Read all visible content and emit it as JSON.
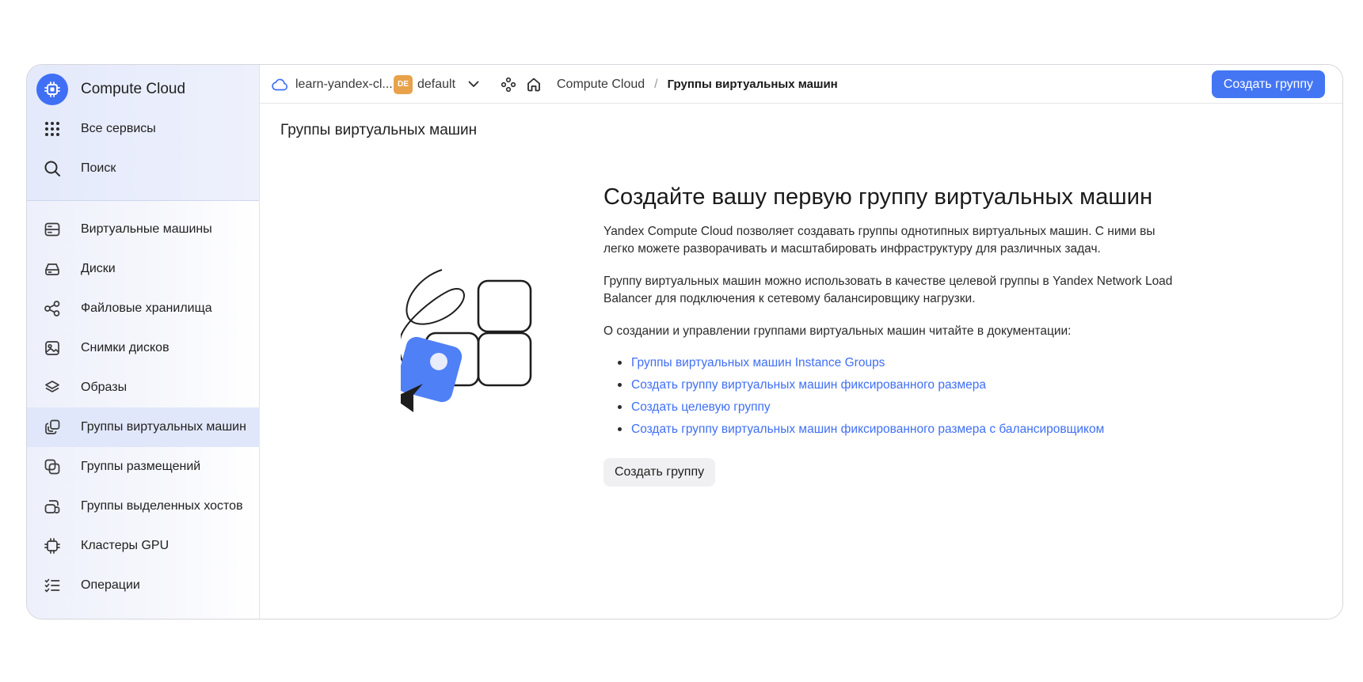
{
  "sidebar": {
    "brand": "Compute Cloud",
    "all_services": "Все сервисы",
    "search": "Поиск",
    "items": [
      {
        "label": "Виртуальные машины",
        "icon": "server-icon"
      },
      {
        "label": "Диски",
        "icon": "disk-icon"
      },
      {
        "label": "Файловые хранилища",
        "icon": "share-nodes-icon"
      },
      {
        "label": "Снимки дисков",
        "icon": "image-icon"
      },
      {
        "label": "Образы",
        "icon": "layers-icon"
      },
      {
        "label": "Группы виртуальных машин",
        "icon": "instance-groups-icon",
        "active": true
      },
      {
        "label": "Группы размещений",
        "icon": "placement-groups-icon"
      },
      {
        "label": "Группы выделенных хостов",
        "icon": "dedicated-hosts-icon"
      },
      {
        "label": "Кластеры GPU",
        "icon": "chip-icon"
      },
      {
        "label": "Операции",
        "icon": "list-check-icon"
      }
    ]
  },
  "topbar": {
    "cloud": "learn-yandex-cl...",
    "folder_badge": "DE",
    "folder": "default",
    "breadcrumb": [
      "Compute Cloud",
      "Группы виртуальных машин"
    ],
    "separator": "/",
    "create_button": "Создать группу"
  },
  "main": {
    "page_title": "Группы виртуальных машин",
    "heading": "Создайте вашу первую группу виртуальных машин",
    "paragraphs": [
      "Yandex Compute Cloud позволяет создавать группы однотипных виртуальных машин. С ними вы легко можете разворачивать и масштабировать инфраструктуру для различных задач.",
      "Группу виртуальных машин можно использовать в качестве целевой группы в Yandex Network Load Balancer для подключения к сетевому балансировщику нагрузки.",
      "О создании и управлении группами виртуальных машин читайте в документации:"
    ],
    "links": [
      "Группы виртуальных машин Instance Groups",
      "Создать группу виртуальных машин фиксированного размера",
      "Создать целевую группу",
      "Создать группу виртуальных машин фиксированного размера с балансировщиком"
    ],
    "create_button": "Создать группу"
  },
  "colors": {
    "accent": "#4476f4",
    "link": "#3f6ff5",
    "folder_badge": "#e8a24b",
    "sidebar_active": "#e1e7fa"
  }
}
